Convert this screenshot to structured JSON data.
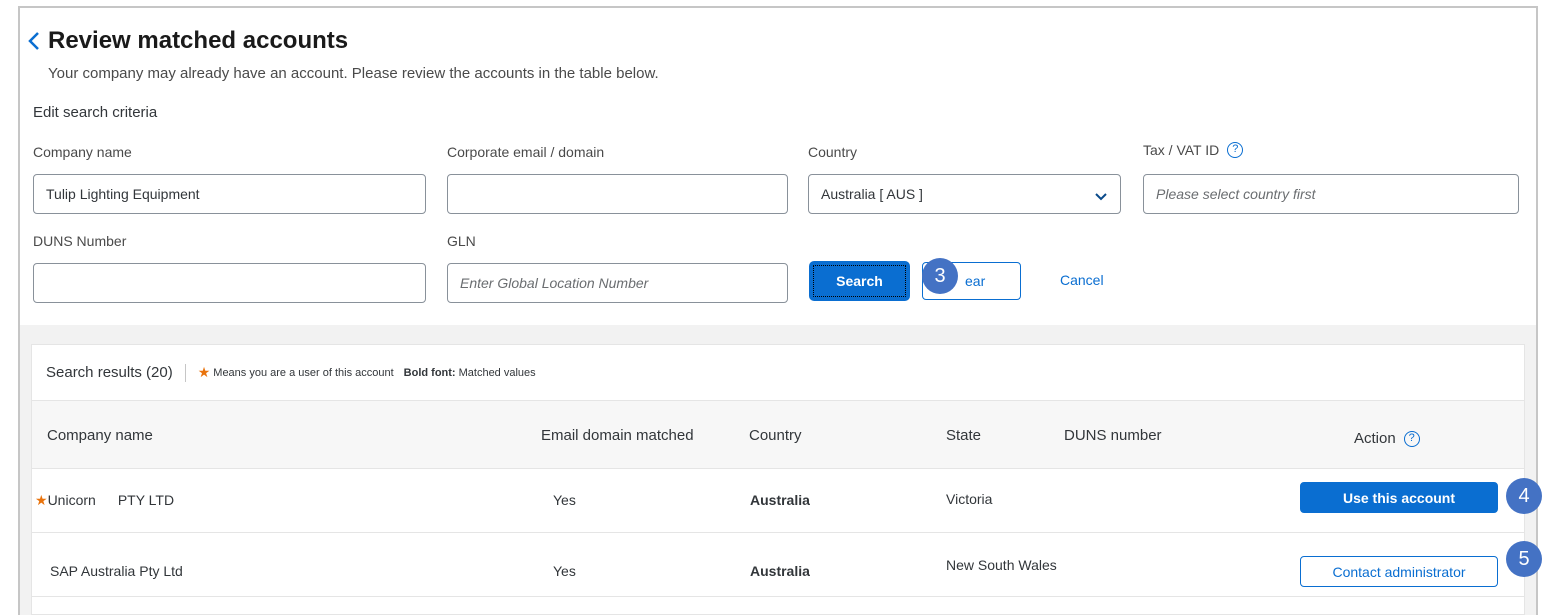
{
  "page": {
    "title": "Review matched accounts",
    "subtitle": "Your company may already have an account. Please review the accounts in the table below.",
    "section_label": "Edit search criteria"
  },
  "form": {
    "company_name": {
      "label": "Company name",
      "value": "Tulip Lighting Equipment"
    },
    "corporate_email": {
      "label": "Corporate email / domain",
      "value": ""
    },
    "country": {
      "label": "Country",
      "selected": "Australia [ AUS ]"
    },
    "tax_id": {
      "label": "Tax / VAT ID",
      "placeholder": "Please select country first"
    },
    "duns": {
      "label": "DUNS Number",
      "value": ""
    },
    "gln": {
      "label": "GLN",
      "placeholder": "Enter Global Location Number"
    },
    "search_label": "Search",
    "clear_label": "Clear",
    "clear_visible_text": "ear",
    "cancel_label": "Cancel"
  },
  "results": {
    "count_label": "Search results (20)",
    "legend_star_text": "Means you are a user of this account",
    "legend_bold_label": "Bold font:",
    "legend_bold_desc": "Matched values",
    "columns": [
      "Company name",
      "Email domain matched",
      "Country",
      "State",
      "DUNS number",
      "Action"
    ],
    "rows": [
      {
        "starred": true,
        "company_part1": "Unicorn",
        "company_part2": "PTY LTD",
        "email_matched": "Yes",
        "country": "Australia",
        "state": "Victoria",
        "duns": "",
        "action": "Use this account"
      },
      {
        "starred": false,
        "company": "SAP Australia Pty Ltd",
        "email_matched": "Yes",
        "country": "Australia",
        "state": "New South Wales",
        "duns": "",
        "action": "Contact administrator"
      }
    ]
  },
  "callouts": {
    "step3": "3",
    "step4": "4",
    "step5": "5"
  },
  "colors": {
    "accent": "#0a6ed1",
    "star": "#e9730c",
    "callout": "#4472c4"
  }
}
